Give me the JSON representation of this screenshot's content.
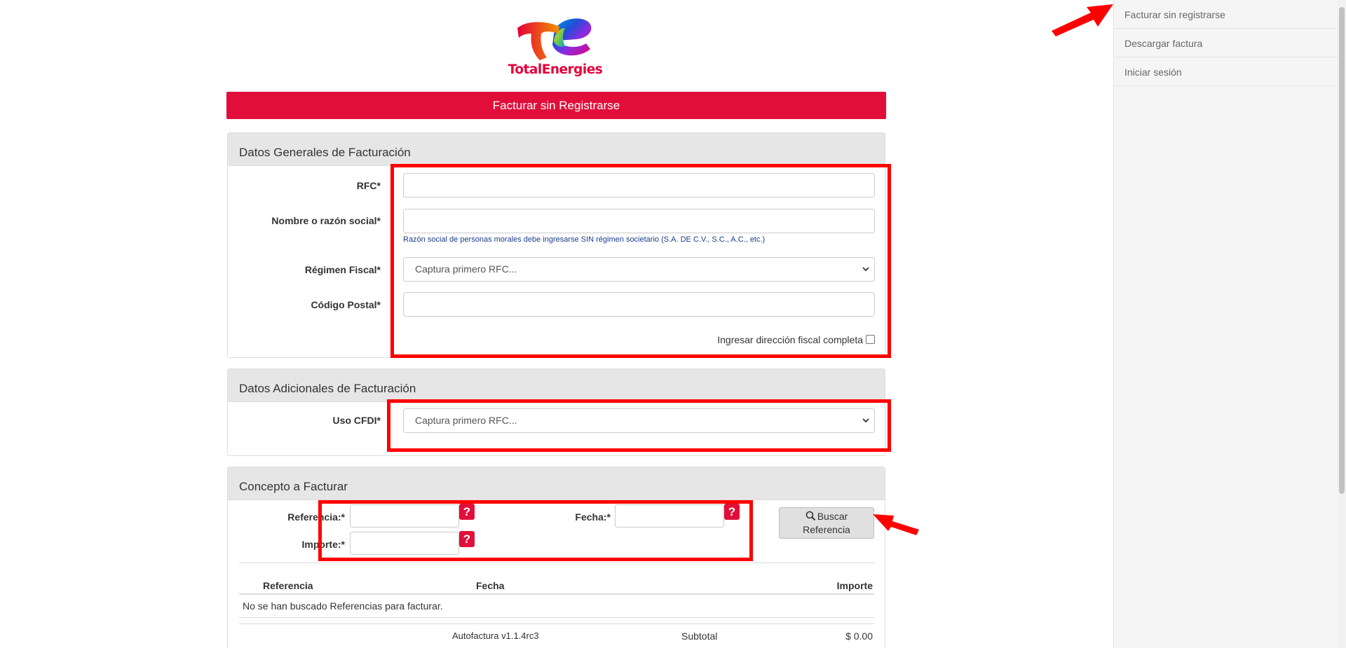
{
  "brand": {
    "name": "TotalEnergies",
    "color": "#e20e3a"
  },
  "banner": {
    "title": "Facturar sin Registrarse"
  },
  "datos_generales": {
    "heading": "Datos Generales de Facturación",
    "rfc_label": "RFC*",
    "nombre_label": "Nombre o razón social*",
    "nombre_hint": "Razón social de personas morales debe ingresarse SIN régimen societario (S.A. DE C.V., S.C., A.C., etc.)",
    "regimen_label": "Régimen Fiscal*",
    "regimen_value": "Captura primero RFC...",
    "cp_label": "Código Postal*",
    "direccion_label": "Ingresar dirección fiscal completa"
  },
  "datos_adicionales": {
    "heading": "Datos Adicionales de Facturación",
    "uso_label": "Uso CFDI*",
    "uso_value": "Captura primero RFC..."
  },
  "concepto": {
    "heading": "Concepto a Facturar",
    "referencia_label": "Referencia:*",
    "fecha_label": "Fecha:*",
    "importe_label": "Importe:*",
    "help_glyph": "?",
    "buscar_label_1": "Buscar",
    "buscar_label_2": "Referencia",
    "table": {
      "columns": [
        "Referencia",
        "Fecha",
        "Importe"
      ],
      "empty_message": "No se han buscado Referencias para facturar."
    },
    "footer": {
      "version": "Autofactura v1.1.4rc3",
      "subtotal_label": "Subtotal",
      "subtotal_value": "$ 0.00"
    }
  },
  "sidebar": {
    "items": [
      {
        "label": "Facturar sin registrarse"
      },
      {
        "label": "Descargar factura"
      },
      {
        "label": "Iniciar sesión"
      }
    ]
  },
  "annotation_color": "#ff0000"
}
